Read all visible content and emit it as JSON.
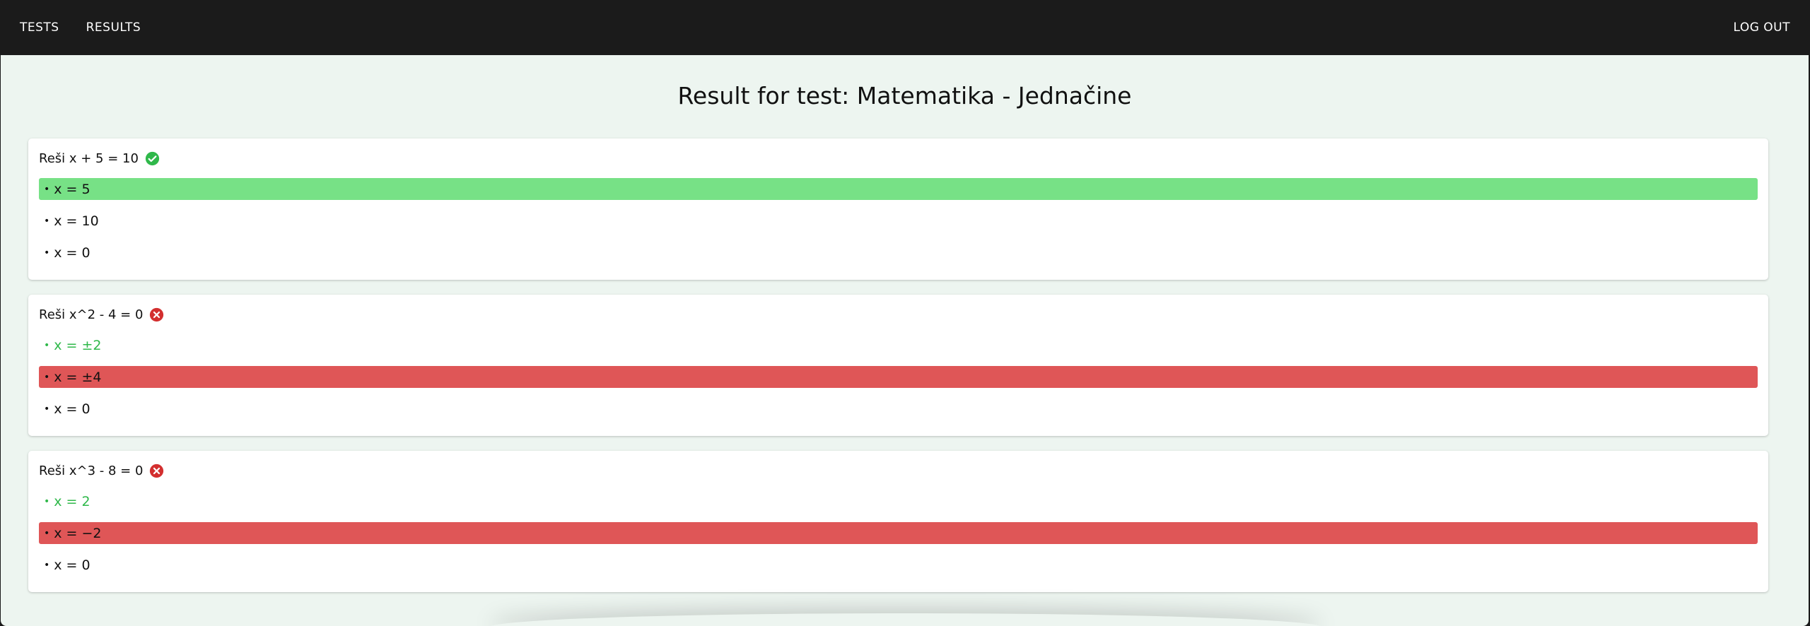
{
  "nav": {
    "tests_label": "TESTS",
    "results_label": "RESULTS",
    "logout_label": "LOG OUT"
  },
  "page_title": "Result for test: Matematika - Jednačine",
  "colors": {
    "correct_fill": "#77e186",
    "wrong_fill": "#df5657",
    "correct_text": "#2fb84a",
    "icon_correct": "#2fb84a",
    "icon_wrong": "#d32f2f"
  },
  "questions": [
    {
      "text": "Reši x + 5 = 10",
      "status": "correct",
      "answers": [
        {
          "text": "x = 5",
          "state": "selected-correct"
        },
        {
          "text": "x = 10",
          "state": "none"
        },
        {
          "text": "x = 0",
          "state": "none"
        }
      ]
    },
    {
      "text": "Reši x^2 - 4 = 0",
      "status": "wrong",
      "answers": [
        {
          "text": "x = ±2",
          "state": "correct-text"
        },
        {
          "text": "x = ±4",
          "state": "selected-wrong"
        },
        {
          "text": "x = 0",
          "state": "none"
        }
      ]
    },
    {
      "text": "Reši x^3 - 8 = 0",
      "status": "wrong",
      "answers": [
        {
          "text": "x = 2",
          "state": "correct-text"
        },
        {
          "text": "x = −2",
          "state": "selected-wrong"
        },
        {
          "text": "x = 0",
          "state": "none"
        }
      ]
    }
  ]
}
